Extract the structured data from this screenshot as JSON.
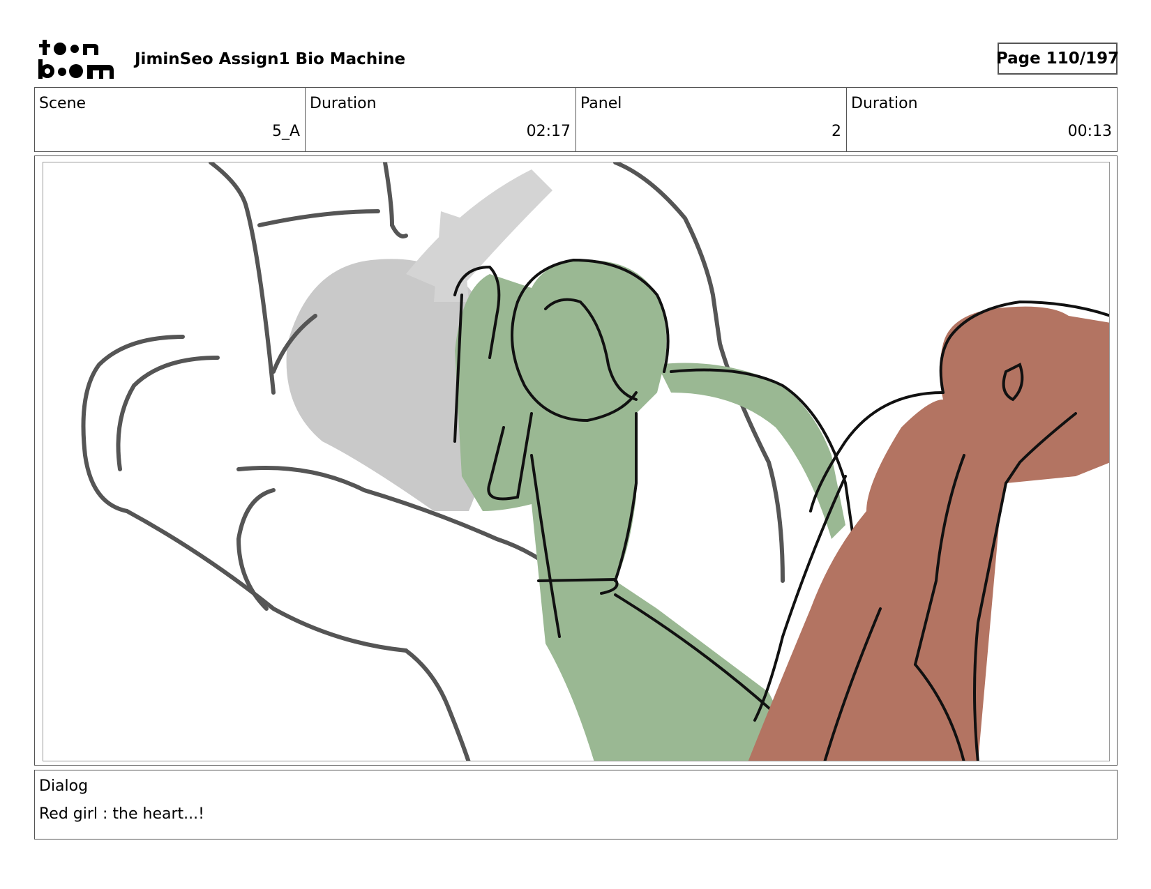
{
  "header": {
    "project_title": "JiminSeo Assign1 Bio Machine",
    "page_label": "Page 110/197",
    "logo": {
      "text_top": "toon",
      "text_bottom": "boom"
    }
  },
  "info": {
    "scene_label": "Scene",
    "scene_value": "5_A",
    "scene_duration_label": "Duration",
    "scene_duration_value": "02:17",
    "panel_label": "Panel",
    "panel_value": "2",
    "panel_duration_label": "Duration",
    "panel_duration_value": "00:13"
  },
  "panel_image": {
    "icon": "storyboard-sketch",
    "colors": {
      "green_character": "#9ab893",
      "red_character": "#b37462",
      "grey_shading": "#c9c9c9"
    }
  },
  "dialog": {
    "label": "Dialog",
    "text": "Red girl : the heart...!"
  }
}
